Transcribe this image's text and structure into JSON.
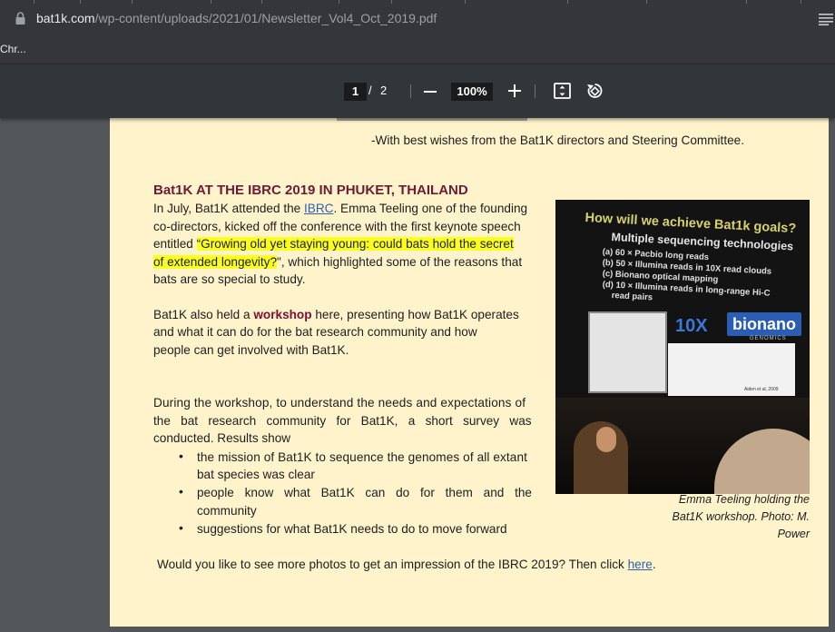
{
  "browser": {
    "url_host": "bat1k.com",
    "url_path": "/wp-content/uploads/2021/01/Newsletter_Vol4_Oct_2019.pdf",
    "bookmark": "Chr..."
  },
  "pdf_toolbar": {
    "current_page": "1",
    "separator": "/",
    "total_pages": "2",
    "zoom": "100%"
  },
  "document": {
    "signoff": "-With best wishes from the Bat1K directors and Steering Committee.",
    "heading": "Bat1K AT THE IBRC 2019 IN PHUKET, THAILAND",
    "para1": {
      "l1_a": "In July, Bat1K attended the ",
      "l1_link": "IBRC",
      "l1_b": ". Emma Teeling one of the founding",
      "l2": "co-directors, kicked off the conference with the first keynote speech",
      "l3_a": "entitled ",
      "l3_hl1": "“Growing old yet staying young: could ",
      "l3_hl2": "bats hold the secret",
      "l4_hl": "of extended longevity?",
      "l4_b": "\", which highlighted some of the reasons that",
      "l5": "bats are so special to study."
    },
    "para2": {
      "l1_a": "Bat1K also held a ",
      "l1_bold": "workshop",
      "l1_b": " here, presenting how Bat1K operates",
      "l2": "and what it can do for the bat research community and how",
      "l3": "people can get involved with Bat1K."
    },
    "para3": {
      "l1": "During the workshop, to understand the needs and expectations of",
      "l2": "the bat research community for Bat1K, a short survey was",
      "l3": "conducted. Results show"
    },
    "bullets": [
      {
        "l1": "the mission of Bat1K to sequence the genomes of all extant",
        "l2": "bat species was clear"
      },
      {
        "l1": "people know what Bat1K can do for them and the",
        "l2": "community"
      },
      {
        "l1": "suggestions for what Bat1K needs to do to move forward",
        "l2": ""
      }
    ],
    "closing_a": "Would you like to see more photos to get an impression of the IBRC 2019? Then click ",
    "closing_link": "here",
    "closing_b": ".",
    "caption": {
      "l1": "Emma Teeling holding the",
      "l2": "Bat1K workshop. Photo: M.",
      "l3": "Power"
    },
    "slide": {
      "title": "How will we achieve Bat1k goals?",
      "subtitle": "Multiple sequencing technologies",
      "items": [
        "(a) 60 × Pacbio long reads",
        "(b) 50 × Illumina reads in 10X read clouds",
        "(c) Bionano optical mapping",
        "(d) 10 × Illumina reads in long-range Hi-C",
        "read pairs"
      ],
      "logo_10x": "10X",
      "logo_bionano": "bionano",
      "logo_genomics": "GENOMICS",
      "citation": "Aiden et al, 2009"
    }
  }
}
